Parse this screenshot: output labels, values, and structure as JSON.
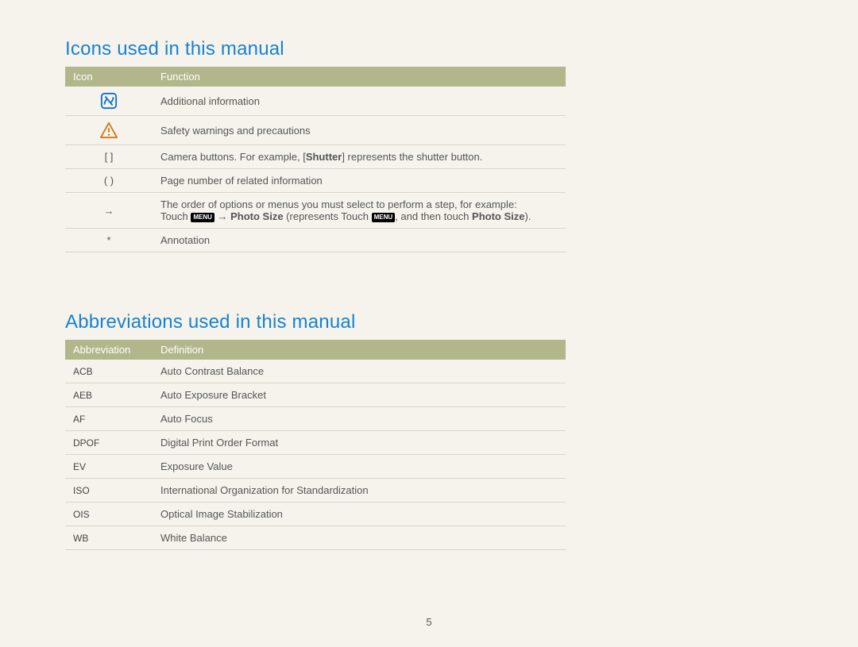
{
  "headings": {
    "icons": "Icons used in this manual",
    "abbr": "Abbreviations used in this manual"
  },
  "icons_table": {
    "headers": {
      "icon": "Icon",
      "function": "Function"
    },
    "rows": {
      "note": {
        "desc": "Additional information"
      },
      "warning": {
        "desc": "Safety warnings and precautions"
      },
      "brackets": {
        "symbol": "[  ]",
        "desc_pre": "Camera buttons. For example, [",
        "desc_bold": "Shutter",
        "desc_post": "] represents the shutter button."
      },
      "parens": {
        "symbol": "(  )",
        "desc": "Page number of related information"
      },
      "arrow": {
        "symbol": "→",
        "line1": "The order of options or menus you must select to perform a step, for example:",
        "l2_a": "Touch ",
        "menu": "MENU",
        "l2_b": " → ",
        "l2_bold1": "Photo Size",
        "l2_c": " (represents Touch ",
        "l2_d": ", and then touch ",
        "l2_bold2": "Photo Size",
        "l2_e": ")."
      },
      "star": {
        "symbol": "*",
        "desc": "Annotation"
      }
    }
  },
  "abbr_table": {
    "headers": {
      "abbr": "Abbreviation",
      "def": "Definition"
    },
    "rows": [
      {
        "abbr": "ACB",
        "def": "Auto Contrast Balance"
      },
      {
        "abbr": "AEB",
        "def": "Auto Exposure Bracket"
      },
      {
        "abbr": "AF",
        "def": "Auto Focus"
      },
      {
        "abbr": "DPOF",
        "def": "Digital Print Order Format"
      },
      {
        "abbr": "EV",
        "def": "Exposure Value"
      },
      {
        "abbr": "ISO",
        "def": "International Organization for Standardization"
      },
      {
        "abbr": "OIS",
        "def": "Optical Image Stabilization"
      },
      {
        "abbr": "WB",
        "def": "White Balance"
      }
    ]
  },
  "page_number": "5"
}
